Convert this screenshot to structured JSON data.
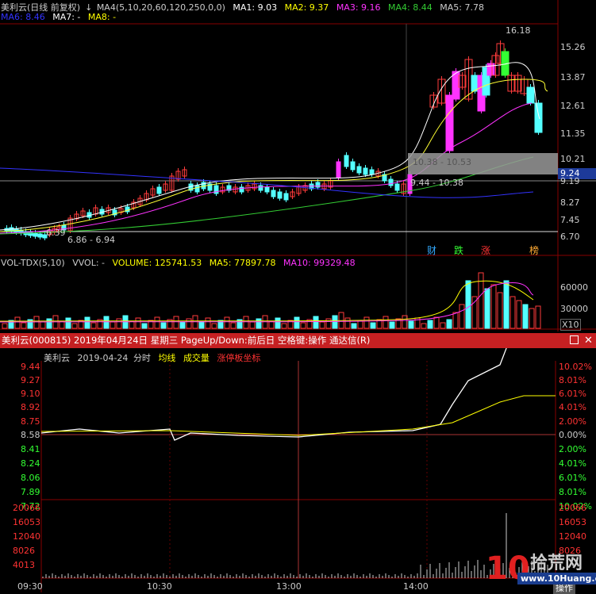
{
  "kline_header": {
    "stock_label": "美利云(日线 前复权)",
    "ma4_params": "MA4(5,10,20,60,120,250,0,0)",
    "ma1": "MA1: 9.03",
    "ma2": "MA2: 9.37",
    "ma3": "MA3: 9.16",
    "ma4": "MA4: 8.44",
    "ma5": "MA5: 7.78",
    "ma6": "MA6: 8.46",
    "ma7": "MA7: -",
    "ma8": "MA8: -"
  },
  "kline": {
    "price_axis": [
      "15.26",
      "13.87",
      "12.61",
      "11.35",
      "10.21",
      "9.19",
      "8.27",
      "7.45",
      "6.70"
    ],
    "current_price_tag": "9.24",
    "high_label": "16.18",
    "low_label": "6.39",
    "range_low": "6.86 - 6.94",
    "range_box": "10.38 - 10.53",
    "range_mid": "9.44 - 10.38",
    "event_tags": [
      "财",
      "跌",
      "涨",
      "榜"
    ],
    "colors": {
      "up": "#ff3b3b",
      "down": "#54ffff",
      "ma1": "#ffffff",
      "ma2": "#ffff33",
      "ma3": "#ff33ff",
      "ma4": "#33cc33",
      "ma5": "#3333ff",
      "limit_up_fill": "#ff33ff",
      "limit_down_fill": "#33ff33"
    }
  },
  "volume_header": {
    "name": "VOL-TDX(5,10)",
    "vvol": "VVOL: -",
    "volume": "VOLUME: 125741.53",
    "ma5": "MA5: 77897.78",
    "ma10": "MA10: 99329.48"
  },
  "volume": {
    "axis": [
      "60000",
      "30000"
    ],
    "unit": "X10"
  },
  "intraday_title": "美利云(000815) 2019年04月24日 星期三 PageUp/Down:前后日 空格键:操作 通达信(R)",
  "intraday_header": {
    "name": "美利云",
    "date": "2019-04-24",
    "mode": "分时",
    "avg_line": "均线",
    "volume": "成交量",
    "limit": "涨停板坐标"
  },
  "intraday": {
    "price_axis_left": [
      "9.44",
      "9.27",
      "9.10",
      "8.92",
      "8.75",
      "8.58",
      "8.41",
      "8.24",
      "8.06",
      "7.89",
      "7.72"
    ],
    "pct_axis_right": [
      "10.02%",
      "8.01%",
      "6.01%",
      "4.01%",
      "2.00%",
      "0.00%",
      "2.00%",
      "4.01%",
      "6.01%",
      "8.01%",
      "10.02%"
    ],
    "vol_axis_left": [
      "20066",
      "16053",
      "12040",
      "8026",
      "4013"
    ],
    "vol_axis_right": [
      "20066",
      "16053",
      "12040",
      "8026"
    ],
    "time_axis": [
      "09:30",
      "10:30",
      "13:00",
      "14:00"
    ],
    "bottom_button": "操作"
  },
  "watermark": {
    "text": "拾荒网",
    "url": "www.10Huang.cn",
    "digits": "10"
  }
}
